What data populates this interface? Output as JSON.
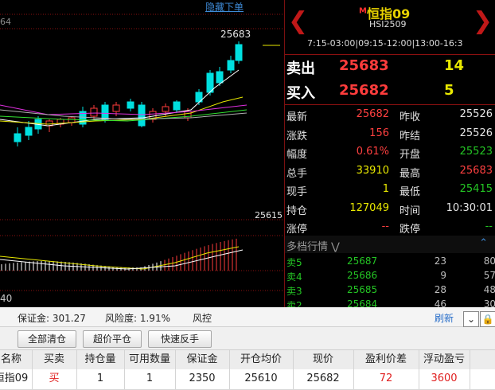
{
  "chart": {
    "hide_link": "隐藏下单",
    "top_num": "64",
    "high_label": "25683",
    "low_label": "25615",
    "bottom_num": "40",
    "colors": {
      "up": "#ff3b3b",
      "down": "#00e0e0",
      "ma1": "#ffffff",
      "ma2": "#e8e800",
      "ma3": "#e030e0",
      "ma4": "#30e030",
      "grid": "#8b1010"
    }
  },
  "quote": {
    "prev_icon": "chevron-left-icon",
    "next_icon": "chevron-right-icon",
    "marker": "M",
    "title": "恒指09",
    "code": "HSI2509",
    "session": "7:15-03:00|09:15-12:00|13:00-16:3",
    "ask": {
      "label": "卖出",
      "price": "25683",
      "vol": "14"
    },
    "bid": {
      "label": "买入",
      "price": "25682",
      "vol": "5"
    },
    "stats": [
      {
        "l1": "最新",
        "v1": "25682",
        "c1": "red",
        "l2": "昨收",
        "v2": "25526",
        "c2": "white"
      },
      {
        "l1": "涨跌",
        "v1": "156",
        "c1": "red",
        "l2": "昨结",
        "v2": "25526",
        "c2": "white"
      },
      {
        "l1": "幅度",
        "v1": "0.61%",
        "c1": "red",
        "l2": "开盘",
        "v2": "25523",
        "c2": "green"
      },
      {
        "l1": "总手",
        "v1": "33910",
        "c1": "yellow",
        "l2": "最高",
        "v2": "25683",
        "c2": "red"
      },
      {
        "l1": "现手",
        "v1": "1",
        "c1": "yellow",
        "l2": "最低",
        "v2": "25415",
        "c2": "green"
      },
      {
        "l1": "持仓",
        "v1": "127049",
        "c1": "yellow",
        "l2": "时间",
        "v2": "10:30:01",
        "c2": "white"
      },
      {
        "l1": "涨停",
        "v1": "--",
        "c1": "red",
        "l2": "跌停",
        "v2": "--",
        "c2": "green"
      }
    ],
    "depth_title": "多档行情",
    "depth_icon": "double-chevron-down-icon",
    "collapse_icon": "chevron-up-icon",
    "depth": [
      {
        "label": "卖5",
        "price": "25687",
        "vol": "23",
        "cnt": "80"
      },
      {
        "label": "卖4",
        "price": "25686",
        "vol": "9",
        "cnt": "57"
      },
      {
        "label": "卖3",
        "price": "25685",
        "vol": "28",
        "cnt": "48"
      },
      {
        "label": "卖2",
        "price": "25684",
        "vol": "46",
        "cnt": "30"
      }
    ]
  },
  "account": {
    "margin_label": "保证金: 301.27",
    "risk_label": "风险度: 1.91%",
    "control_label": "风控",
    "refresh": "刷新"
  },
  "buttons": {
    "close_all": "全部清仓",
    "close_over": "超价平仓",
    "reverse": "快速反手"
  },
  "positions": {
    "columns": [
      "名称",
      "买卖",
      "持仓量",
      "可用数量",
      "保证金",
      "开仓均价",
      "现价",
      "盈利价差",
      "浮动盈亏"
    ],
    "rows": [
      {
        "name": "恒指09",
        "side": "买",
        "qty": "1",
        "avail": "1",
        "margin": "2350",
        "open": "25610",
        "price": "25682",
        "diff": "72",
        "pnl": "3600"
      }
    ]
  }
}
